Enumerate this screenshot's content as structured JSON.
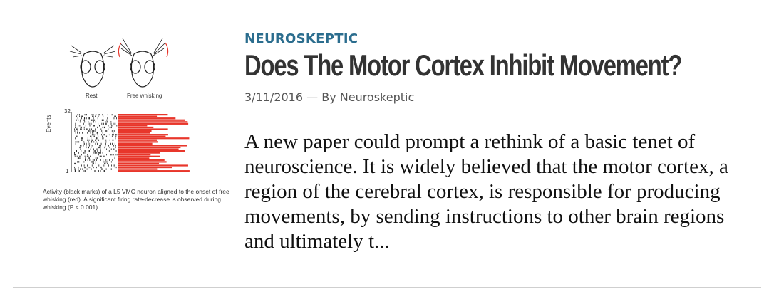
{
  "figure": {
    "label_rest": "Rest",
    "label_free_whisking": "Free whisking",
    "y_axis_title": "Events",
    "y_tick_top": "32",
    "y_tick_bottom": "1",
    "event_color": "#e8362b",
    "caption": "Activity (black marks) of a L5 VMC neuron aligned to the onset of free whisking (red). A significant firing rate-decrease is observed during whisking (P < 0.001)"
  },
  "article": {
    "section": "NEUROSKEPTIC",
    "title": "Does The Motor Cortex Inhibit Movement?",
    "date": "3/11/2016",
    "separator": " — By ",
    "author": "Neuroskeptic",
    "excerpt": "A new paper could prompt a rethink of a basic tenet of neuroscience. It is widely believed that the motor cortex, a region of the cerebral cortex, is responsible for producing movements, by sending instructions to other brain regions and ultimately t..."
  },
  "colors": {
    "section": "#2b6d8e",
    "title": "#333333",
    "divider": "#cfcfcf"
  }
}
